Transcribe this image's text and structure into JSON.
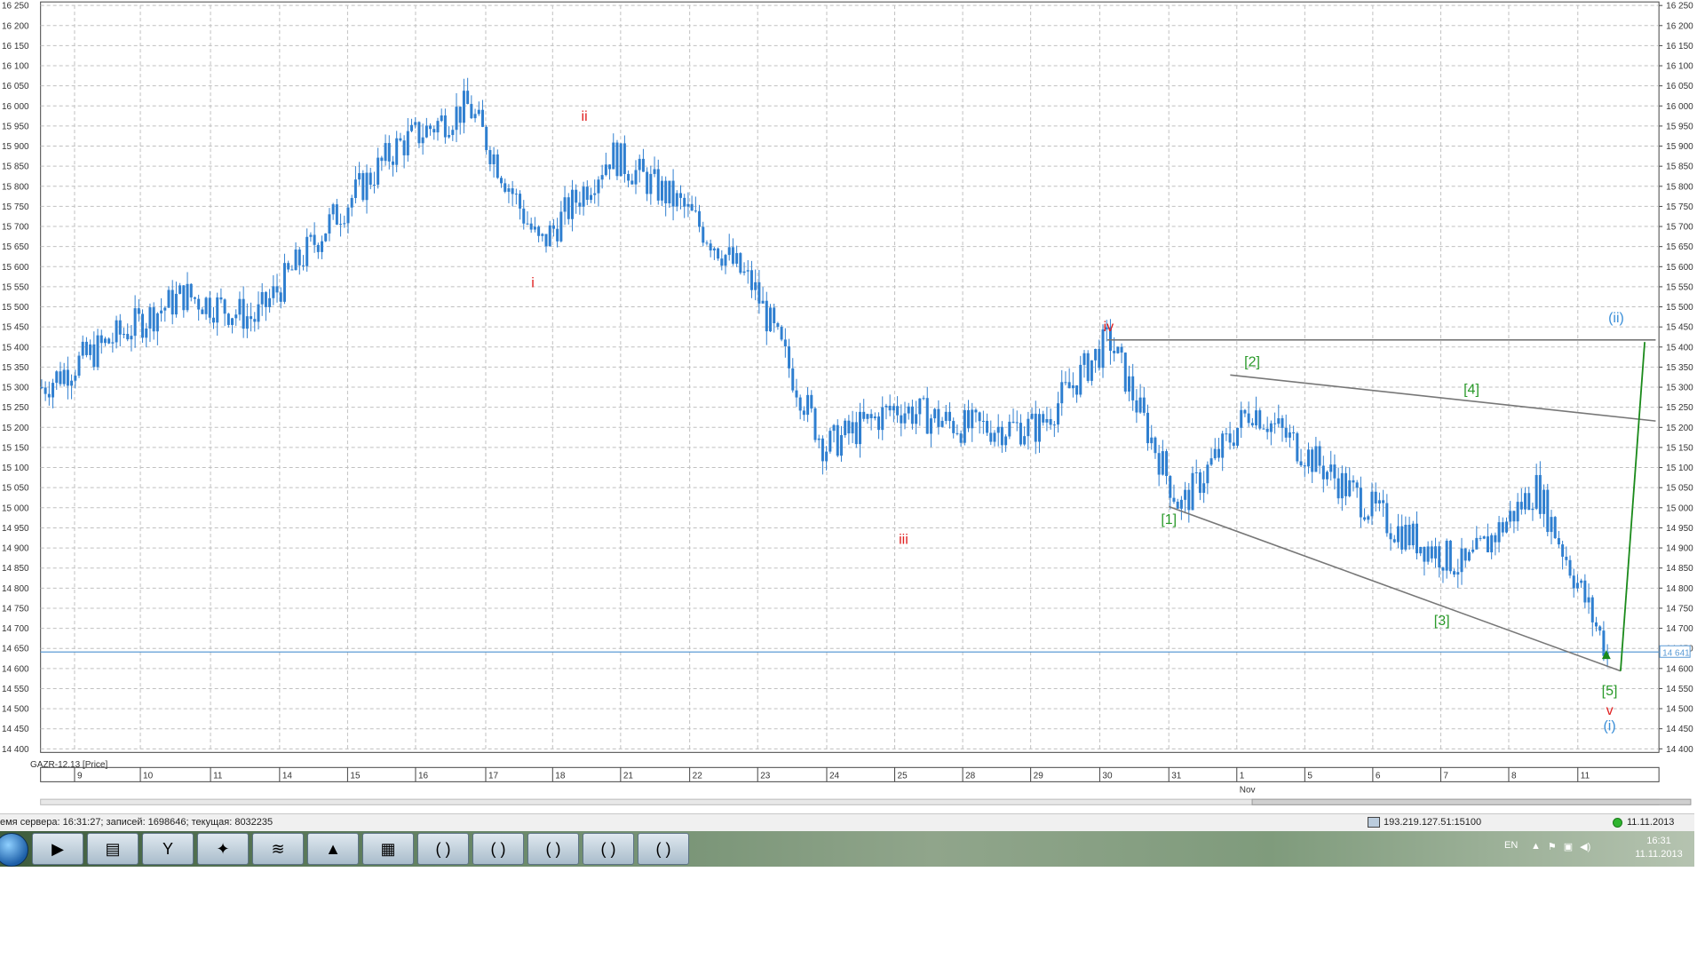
{
  "symbol_label": "GAZR-12.13 [Price]",
  "price_axis": {
    "min": 14400,
    "max": 16250,
    "step": 50,
    "labels": [
      "16 250",
      "16 200",
      "16 150",
      "16 100",
      "16 050",
      "16 000",
      "15 950",
      "15 900",
      "15 850",
      "15 800",
      "15 750",
      "15 700",
      "15 650",
      "15 600",
      "15 550",
      "15 500",
      "15 450",
      "15 400",
      "15 350",
      "15 300",
      "15 250",
      "15 200",
      "15 150",
      "15 100",
      "15 050",
      "15 000",
      "14 950",
      "14 900",
      "14 850",
      "14 800",
      "14 750",
      "14 700",
      "14 650",
      "14 600",
      "14 550",
      "14 500",
      "14 450",
      "14 400"
    ]
  },
  "current_price": {
    "value": 14641,
    "label": "14 641"
  },
  "date_axis": {
    "labels": [
      "9",
      "10",
      "11",
      "14",
      "15",
      "16",
      "17",
      "18",
      "21",
      "22",
      "23",
      "24",
      "25",
      "28",
      "29",
      "30",
      "31",
      "1",
      "5",
      "6",
      "7",
      "8",
      "11"
    ],
    "month_label": "Nov"
  },
  "wave_labels": [
    {
      "text": "i",
      "color": "#e02020"
    },
    {
      "text": "ii",
      "color": "#e02020"
    },
    {
      "text": "iii",
      "color": "#e02020"
    },
    {
      "text": "iv",
      "color": "#e02020"
    },
    {
      "text": "v",
      "color": "#e02020"
    },
    {
      "text": "[1]",
      "color": "#2a9a2a"
    },
    {
      "text": "[2]",
      "color": "#2a9a2a"
    },
    {
      "text": "[3]",
      "color": "#2a9a2a"
    },
    {
      "text": "[4]",
      "color": "#2a9a2a"
    },
    {
      "text": "[5]",
      "color": "#2a9a2a"
    },
    {
      "text": "(i)",
      "color": "#3b8fd8"
    },
    {
      "text": "(ii)",
      "color": "#3b8fd8"
    }
  ],
  "chart_data": {
    "type": "line",
    "title": "GAZR-12.13 [Price]",
    "xlabel": "",
    "ylabel": "",
    "ylim": [
      14400,
      16250
    ],
    "x": [
      "9",
      "10",
      "11",
      "14",
      "15",
      "16",
      "17",
      "18",
      "21",
      "22",
      "23",
      "24",
      "25",
      "28",
      "29",
      "30",
      "31",
      "1 Nov",
      "5",
      "6",
      "7",
      "8",
      "11"
    ],
    "series": [
      {
        "name": "GAZR-12.13 [Price]",
        "values": [
          15300,
          15420,
          15530,
          15470,
          15700,
          15900,
          16000,
          15650,
          15880,
          15750,
          15550,
          15150,
          15250,
          15200,
          15200,
          15420,
          15000,
          15250,
          15100,
          14950,
          14850,
          15050,
          14641
        ]
      }
    ],
    "grid": true,
    "current_value": 14641
  },
  "status": {
    "left_text": "емя сервера: 16:31:27; записей: 1698646; текущая: 8032235",
    "connection": "193.219.127.51:15100",
    "date": "11.11.2013"
  },
  "taskbar": {
    "lang": "EN",
    "time": "16:31",
    "date": "11.11.2013",
    "buttons": [
      {
        "icon": "media-player-icon"
      },
      {
        "icon": "folder-icon"
      },
      {
        "icon": "yandex-browser-icon"
      },
      {
        "icon": "trading-terminal-icon"
      },
      {
        "icon": "alpari-icon",
        "label": "alpari"
      },
      {
        "icon": "triangle-app-icon"
      },
      {
        "icon": "calculator-icon"
      },
      {
        "icon": "quik-icon"
      },
      {
        "icon": "quik-icon"
      },
      {
        "icon": "quik-icon"
      },
      {
        "icon": "quik-icon"
      },
      {
        "icon": "quik-icon"
      }
    ]
  },
  "colors": {
    "candle": "#2f7fd0",
    "price_line": "#5b9bd5",
    "red_wave": "#e02020",
    "green_wave": "#2a9a2a",
    "blue_wave": "#3b8fd8",
    "trend_line": "#777777",
    "projection": "#1a8a1a"
  }
}
